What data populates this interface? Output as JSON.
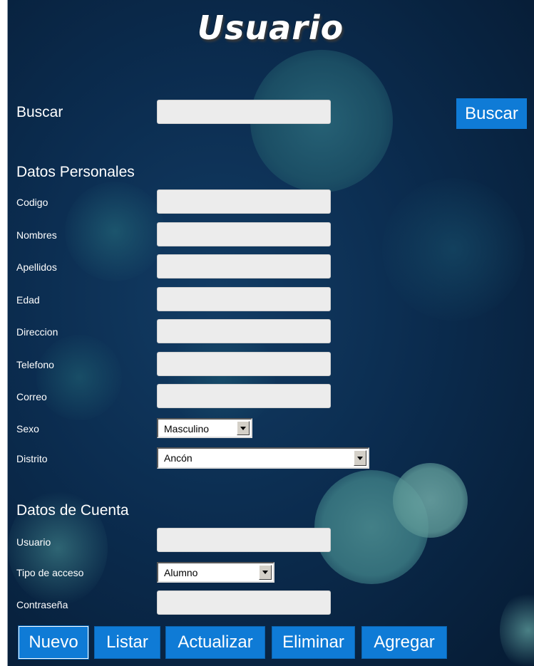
{
  "title": "Usuario",
  "search": {
    "label": "Buscar",
    "value": "",
    "button_label": "Buscar"
  },
  "personal": {
    "heading": "Datos Personales",
    "fields": {
      "codigo": {
        "label": "Codigo",
        "value": ""
      },
      "nombres": {
        "label": "Nombres",
        "value": ""
      },
      "apellidos": {
        "label": "Apellidos",
        "value": ""
      },
      "edad": {
        "label": "Edad",
        "value": ""
      },
      "direccion": {
        "label": "Direccion",
        "value": ""
      },
      "telefono": {
        "label": "Telefono",
        "value": ""
      },
      "correo": {
        "label": "Correo",
        "value": ""
      }
    },
    "sexo": {
      "label": "Sexo",
      "selected": "Masculino"
    },
    "distrito": {
      "label": "Distrito",
      "selected": "Ancón"
    }
  },
  "account": {
    "heading": "Datos de Cuenta",
    "usuario": {
      "label": "Usuario",
      "value": ""
    },
    "tipo_acceso": {
      "label": "Tipo de acceso",
      "selected": "Alumno"
    },
    "contrasena": {
      "label": "Contraseña",
      "value": ""
    }
  },
  "buttons": {
    "nuevo": "Nuevo",
    "listar": "Listar",
    "actualizar": "Actualizar",
    "eliminar": "Eliminar",
    "agregar": "Agregar"
  },
  "colors": {
    "background": "#0b2c4f",
    "button": "#0f7bd6",
    "input": "#ececec"
  }
}
